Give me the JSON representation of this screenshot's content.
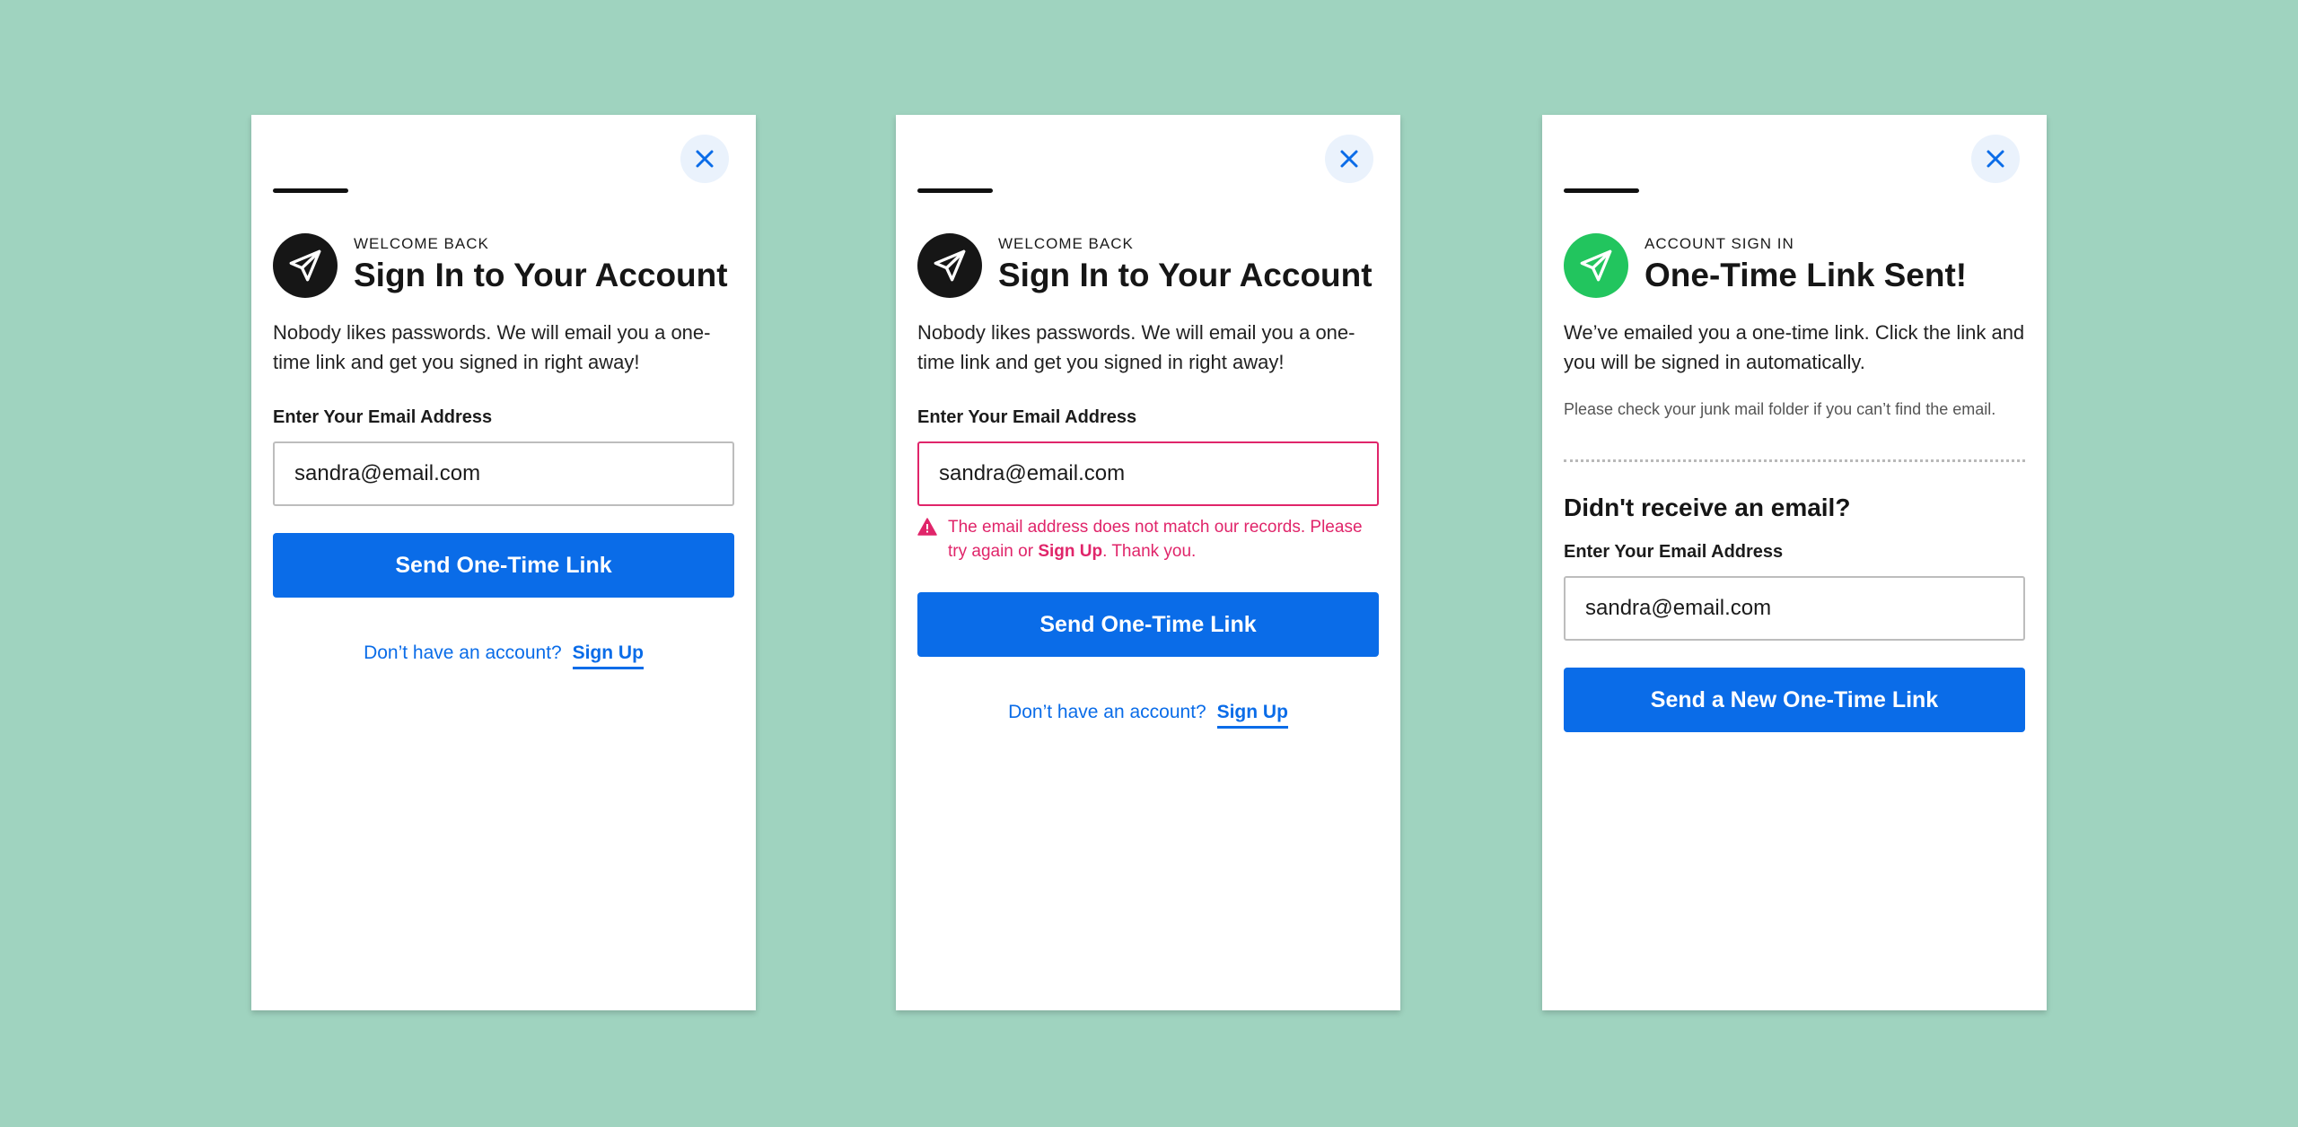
{
  "colors": {
    "background": "#9fd3bf",
    "primary": "#0a6ce8",
    "error": "#e0256a",
    "success": "#22c55e"
  },
  "icons": {
    "close": "close-icon",
    "send": "paper-plane-icon",
    "warning": "warning-icon"
  },
  "panel1": {
    "eyebrow": "WELCOME BACK",
    "title": "Sign In to Your Account",
    "description": "Nobody likes passwords. We will email you a one-time link and get you signed in right away!",
    "email_label": "Enter Your Email Address",
    "email_value": "sandra@email.com",
    "button": "Send One-Time Link",
    "signup_prompt": "Don’t have an account?",
    "signup_link": "Sign Up"
  },
  "panel2": {
    "eyebrow": "WELCOME BACK",
    "title": "Sign In to Your Account",
    "description": "Nobody likes passwords. We will email you a one-time link and get you signed in right away!",
    "email_label": "Enter Your Email Address",
    "email_value": "sandra@email.com",
    "error_text_before": "The email address does not match our records. Please try again or ",
    "error_link": "Sign Up",
    "error_text_after": ". Thank you.",
    "button": "Send One-Time Link",
    "signup_prompt": "Don’t have an account?",
    "signup_link": "Sign Up"
  },
  "panel3": {
    "eyebrow": "ACCOUNT SIGN IN",
    "title": "One-Time Link Sent!",
    "description": "We’ve emailed you a one-time link. Click the link and you will be signed in automatically.",
    "hint": "Please check your junk mail folder if you can’t find the email.",
    "subheading": "Didn't receive an email?",
    "email_label": "Enter Your Email Address",
    "email_value": "sandra@email.com",
    "button": "Send a New One-Time Link"
  }
}
